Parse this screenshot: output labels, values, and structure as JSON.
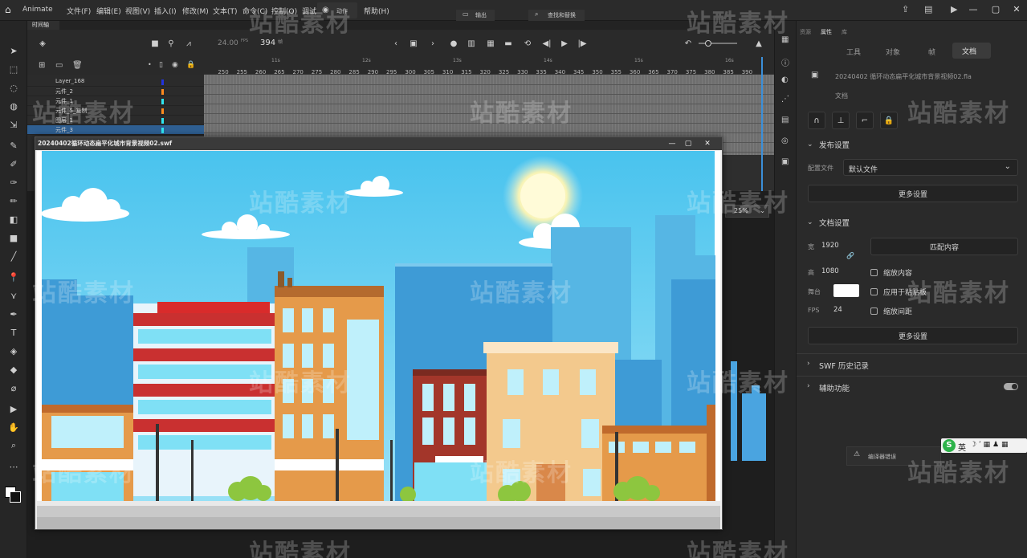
{
  "menubar": {
    "app_name": "Animate",
    "items": [
      "文件(F)",
      "编辑(E)",
      "视图(V)",
      "插入(I)",
      "修改(M)",
      "文本(T)",
      "命令(C)",
      "控制(O)",
      "调试",
      "窗口",
      "帮助(H)"
    ],
    "panels": {
      "actions": "动作",
      "output": "输出",
      "find_replace": "查找和替换"
    }
  },
  "timeline": {
    "tab_label": "时间轴",
    "fps": "24.00",
    "fps_unit": "FPS",
    "current_frame": "394",
    "frame_unit": "帧",
    "layers": [
      {
        "name": "Layer_168",
        "color": "#2233dd"
      },
      {
        "name": "元件_2",
        "color": "#ff8a1e"
      },
      {
        "name": "元件_1",
        "color": "#2ee6f0"
      },
      {
        "name": "元件_5_复制",
        "color": "#ff8a1e"
      },
      {
        "name": "图层_1",
        "color": "#2ee6f0"
      },
      {
        "name": "元件_3",
        "color": "#2ee6f0"
      }
    ],
    "frame_ticks": [
      "250",
      "255",
      "260",
      "265",
      "270",
      "275",
      "280",
      "285",
      "290",
      "295",
      "300",
      "305",
      "310",
      "315",
      "320",
      "325",
      "330",
      "335",
      "340",
      "345",
      "350",
      "355",
      "360",
      "365",
      "370",
      "375",
      "380",
      "385",
      "390"
    ],
    "seconds": [
      "11s",
      "12s",
      "13s",
      "14s",
      "15s",
      "16s"
    ],
    "zoom": "25%"
  },
  "swf_window": {
    "title": "20240402循环动态扁平化城市背景视频02.swf"
  },
  "properties": {
    "tabs": [
      "工具",
      "对象",
      "帧",
      "文档"
    ],
    "active_tab": "文档",
    "header_tabs": [
      "资源",
      "属性",
      "库"
    ],
    "file_name": "20240402 循环动态扁平化城市背景视频02.fla",
    "file_kind": "文档",
    "publish_section": "发布设置",
    "profile_label": "配置文件",
    "profile_value": "默认文件",
    "more_settings": "更多设置",
    "doc_section": "文档设置",
    "width_label": "宽",
    "width_value": "1920",
    "height_label": "高",
    "height_value": "1080",
    "match_contents": "匹配内容",
    "stage_label": "舞台",
    "fps_label": "FPS",
    "fps_value": "24",
    "scale_content": "缩放内容",
    "apply_pasteboard": "应用于粘贴板",
    "scale_spacing": "缩放间距",
    "more_settings2": "更多设置",
    "swf_history": "SWF 历史记录",
    "accessibility": "辅助功能",
    "compiler_errors": "编译器错误",
    "ime": "英"
  },
  "watermark": "站酷素材",
  "colors": {
    "sky": "#5ec8ef",
    "playhead": "#3b8fd9",
    "panel": "#2a2a2a"
  }
}
